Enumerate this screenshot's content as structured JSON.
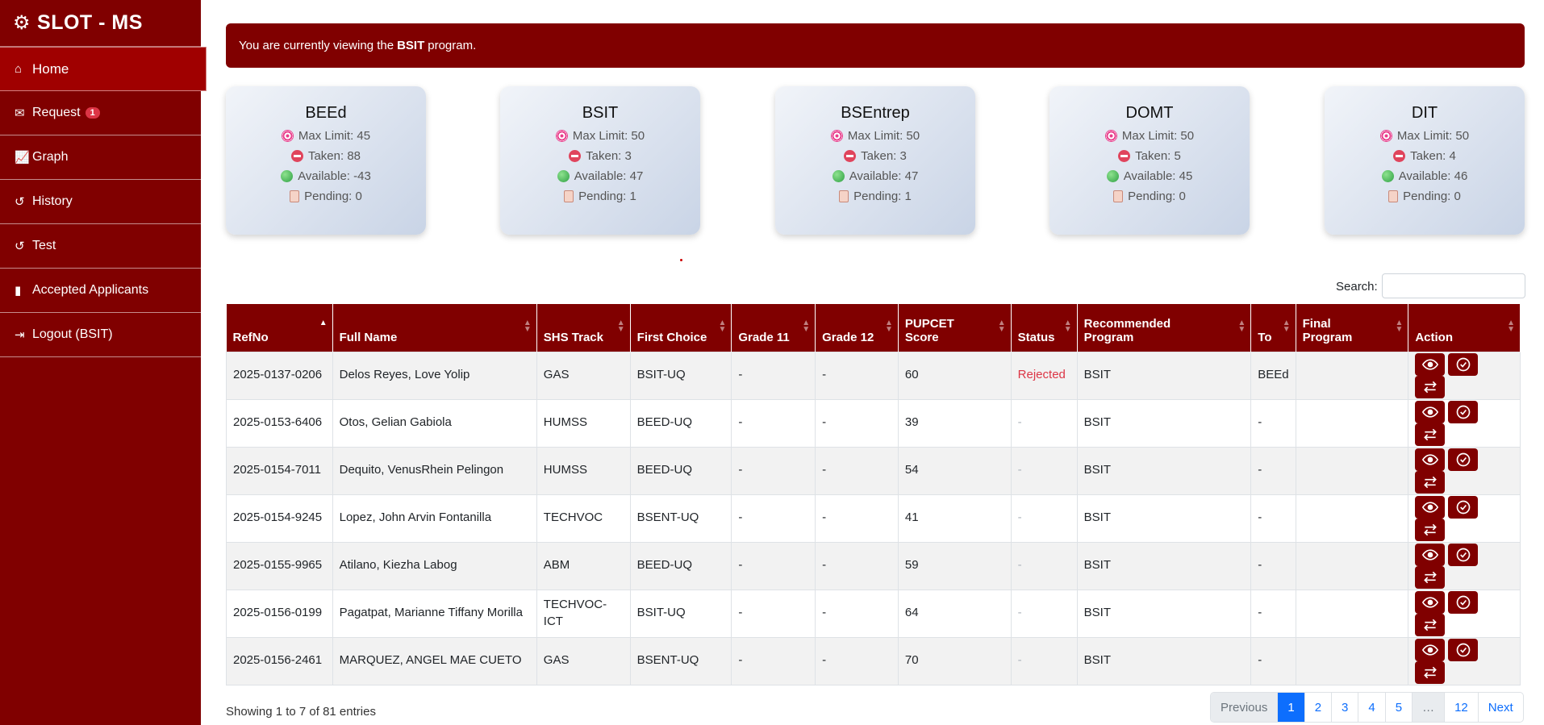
{
  "app": {
    "title": "SLOT - MS"
  },
  "sidebar": {
    "items": [
      {
        "label": "Home",
        "icon": "home-icon"
      },
      {
        "label": "Request",
        "icon": "envelope-icon",
        "badge": "1"
      },
      {
        "label": "Graph",
        "icon": "chart-icon"
      },
      {
        "label": "History",
        "icon": "history-icon"
      },
      {
        "label": "Test",
        "icon": "history-icon"
      },
      {
        "label": "Accepted Applicants",
        "icon": "file-icon"
      },
      {
        "label": "Logout (BSIT)",
        "icon": "logout-icon"
      }
    ]
  },
  "alert": {
    "prefix": "You are currently viewing the",
    "program": "BSIT",
    "suffix": "program."
  },
  "cards": [
    {
      "title": "BEEd",
      "max": "Max Limit: 45",
      "taken": "Taken: 88",
      "available": "Available: -43",
      "pending": "Pending: 0"
    },
    {
      "title": "BSIT",
      "max": "Max Limit: 50",
      "taken": "Taken: 3",
      "available": "Available: 47",
      "pending": "Pending: 1"
    },
    {
      "title": "BSEntrep",
      "max": "Max Limit: 50",
      "taken": "Taken: 3",
      "available": "Available: 47",
      "pending": "Pending: 1"
    },
    {
      "title": "DOMT",
      "max": "Max Limit: 50",
      "taken": "Taken: 5",
      "available": "Available: 45",
      "pending": "Pending: 0"
    },
    {
      "title": "DIT",
      "max": "Max Limit: 50",
      "taken": "Taken: 4",
      "available": "Available: 46",
      "pending": "Pending: 0"
    }
  ],
  "search": {
    "label": "Search:",
    "value": ""
  },
  "table": {
    "headers": [
      "RefNo",
      "Full Name",
      "SHS Track",
      "First Choice",
      "Grade 11",
      "Grade 12",
      "PUPCET Score",
      "Status",
      "Recommended Program",
      "To",
      "Final Program",
      "Action"
    ],
    "rows": [
      {
        "ref": "2025-0137-0206",
        "name": "Delos Reyes, Love Yolip",
        "track": "GAS",
        "choice": "BSIT-UQ",
        "g11": "-",
        "g12": "-",
        "score": "60",
        "status": "Rejected",
        "rec": "BSIT",
        "to": "BEEd",
        "final": ""
      },
      {
        "ref": "2025-0153-6406",
        "name": "Otos, Gelian Gabiola",
        "track": "HUMSS",
        "choice": "BEED-UQ",
        "g11": "-",
        "g12": "-",
        "score": "39",
        "status": "-",
        "rec": "BSIT",
        "to": "-",
        "final": ""
      },
      {
        "ref": "2025-0154-7011",
        "name": "Dequito, VenusRhein Pelingon",
        "track": "HUMSS",
        "choice": "BEED-UQ",
        "g11": "-",
        "g12": "-",
        "score": "54",
        "status": "-",
        "rec": "BSIT",
        "to": "-",
        "final": ""
      },
      {
        "ref": "2025-0154-9245",
        "name": "Lopez, John Arvin Fontanilla",
        "track": "TECHVOC",
        "choice": "BSENT-UQ",
        "g11": "-",
        "g12": "-",
        "score": "41",
        "status": "-",
        "rec": "BSIT",
        "to": "-",
        "final": ""
      },
      {
        "ref": "2025-0155-9965",
        "name": "Atilano, Kiezha Labog",
        "track": "ABM",
        "choice": "BEED-UQ",
        "g11": "-",
        "g12": "-",
        "score": "59",
        "status": "-",
        "rec": "BSIT",
        "to": "-",
        "final": ""
      },
      {
        "ref": "2025-0156-0199",
        "name": "Pagatpat, Marianne Tiffany Morilla",
        "track": "TECHVOC-ICT",
        "choice": "BSIT-UQ",
        "g11": "-",
        "g12": "-",
        "score": "64",
        "status": "-",
        "rec": "BSIT",
        "to": "-",
        "final": ""
      },
      {
        "ref": "2025-0156-2461",
        "name": "MARQUEZ, ANGEL MAE CUETO",
        "track": "GAS",
        "choice": "BSENT-UQ",
        "g11": "-",
        "g12": "-",
        "score": "70",
        "status": "-",
        "rec": "BSIT",
        "to": "-",
        "final": ""
      }
    ]
  },
  "footer": {
    "info": "Showing 1 to 7 of 81 entries",
    "pager": [
      "Previous",
      "1",
      "2",
      "3",
      "4",
      "5",
      "…",
      "12",
      "Next"
    ]
  }
}
